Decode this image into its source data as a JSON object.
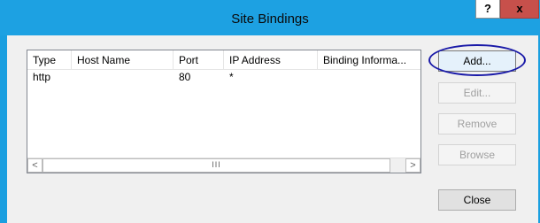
{
  "window": {
    "title": "Site Bindings",
    "help_label": "?",
    "close_label": "x"
  },
  "bindings_table": {
    "columns": [
      "Type",
      "Host Name",
      "Port",
      "IP Address",
      "Binding Informa..."
    ],
    "rows": [
      {
        "type": "http",
        "host_name": "",
        "port": "80",
        "ip_address": "*",
        "binding_info": ""
      }
    ],
    "scroll_left_label": "<",
    "scroll_right_label": ">",
    "scroll_thumb_label": "III"
  },
  "buttons": {
    "add": "Add...",
    "edit": "Edit...",
    "remove": "Remove",
    "browse": "Browse",
    "close": "Close"
  },
  "colors": {
    "title_bar": "#1da1e2",
    "close_button": "#c7504b",
    "annotation_ellipse": "#1a1aa8"
  }
}
